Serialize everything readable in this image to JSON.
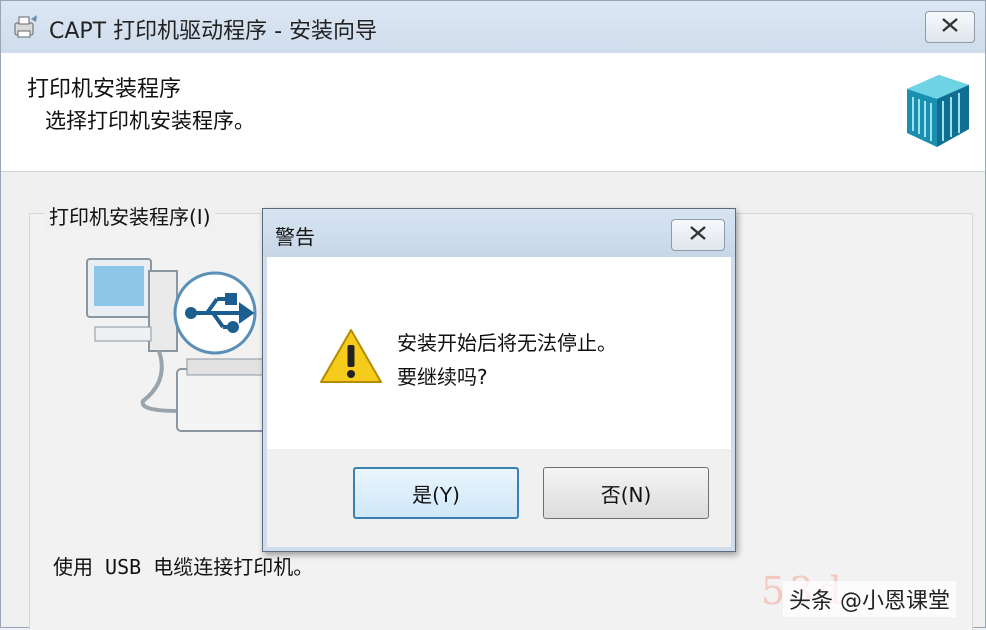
{
  "window": {
    "title": "CAPT 打印机驱动程序 - 安装向导",
    "header_title": "打印机安装程序",
    "header_subtitle": "选择打印机安装程序。",
    "section_label": "打印机安装程序(I)",
    "usb_text": "使用 USB 电缆连接打印机。",
    "icons": {
      "title": "printer-setup-icon",
      "close": "close-icon",
      "logo": "blue-cube-logo-icon",
      "illustration": "computer-usb-printer-illustration"
    }
  },
  "dialog": {
    "title": "警告",
    "message_line1": "安装开始后将无法停止。",
    "message_line2": "要继续吗?",
    "yes_label": "是(Y)",
    "no_label": "否(N)",
    "icons": {
      "warning": "warning-icon",
      "close": "close-icon"
    }
  },
  "watermark": {
    "faint_text": "53d",
    "text": "头条 @小恩课堂"
  },
  "colors": {
    "titlebar": "#cfdceb",
    "accent": "#3c7fb1",
    "warning_yellow": "#f2c200"
  }
}
